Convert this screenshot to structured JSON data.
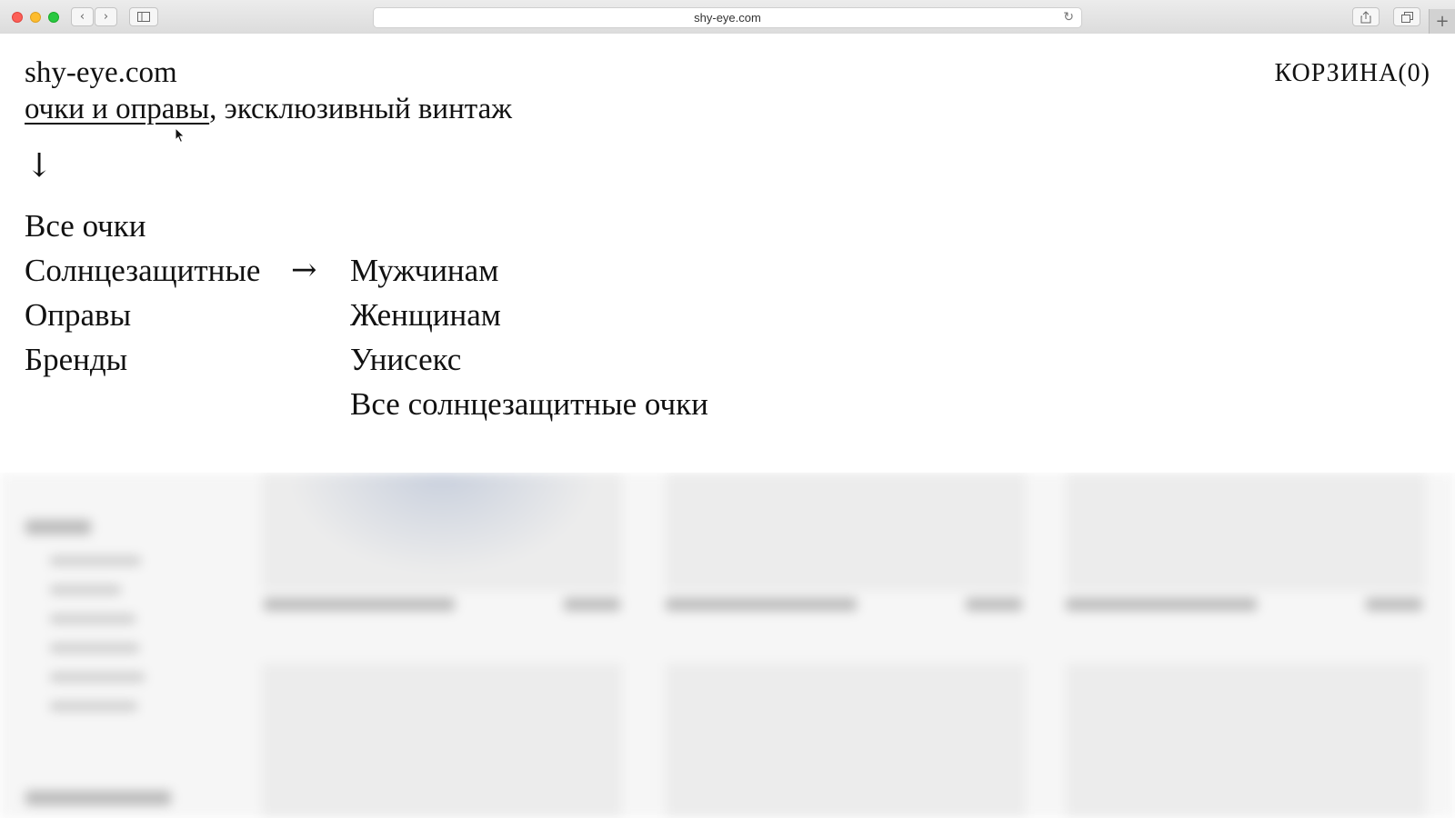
{
  "browser": {
    "url": "shy-eye.com"
  },
  "header": {
    "site_name": "shy-eye.com",
    "tagline_link": "очки и оправы",
    "tagline_rest": ", эксклюзивный винтаж",
    "cart_label": "КОРЗИНА(0)",
    "down_arrow": "↓"
  },
  "menu": {
    "items": [
      "Все очки",
      "Солнцезащитные",
      "Оправы",
      "Бренды"
    ],
    "arrow": "→",
    "submenu": [
      "Мужчинам",
      "Женщинам",
      "Унисекс",
      "Все солнцезащитные очки"
    ]
  }
}
